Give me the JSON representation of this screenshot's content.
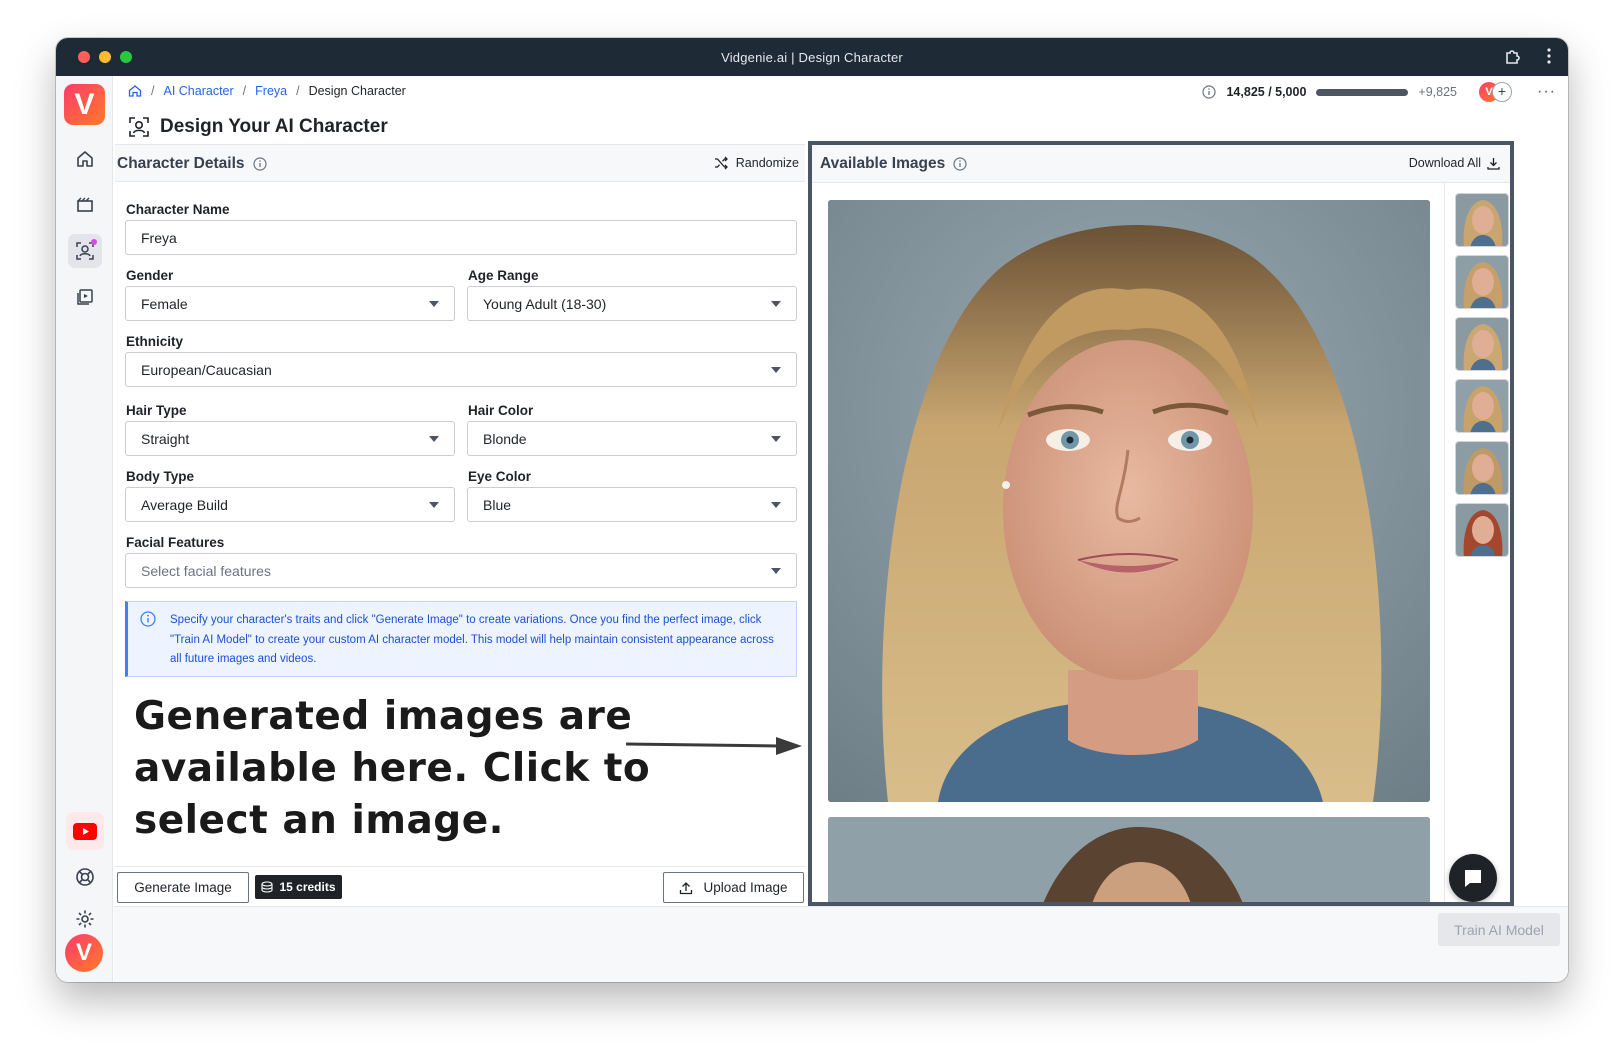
{
  "window": {
    "title": "Vidgenie.ai | Design Character"
  },
  "sidebar": {
    "items": [
      {
        "name": "home",
        "icon": "home-icon"
      },
      {
        "name": "videos",
        "icon": "clapperboard-icon"
      },
      {
        "name": "ai-character",
        "icon": "user-scan-icon",
        "active": true
      },
      {
        "name": "library",
        "icon": "media-library-icon"
      }
    ],
    "bottom": [
      {
        "icon": "youtube-icon"
      },
      {
        "icon": "help-lifebuoy-icon"
      },
      {
        "icon": "gear-icon"
      }
    ]
  },
  "breadcrumb": {
    "home_icon": "home-icon",
    "items": [
      "AI Character",
      "Freya",
      "Design Character"
    ],
    "separator": "/"
  },
  "credits": {
    "current": "14,825 / 5,000",
    "bonus": "+9,825",
    "usage_fraction": 1.0
  },
  "page": {
    "title": "Design Your AI Character"
  },
  "character_details": {
    "title": "Character Details",
    "randomize_label": "Randomize",
    "fields": {
      "name": {
        "label": "Character Name",
        "value": "Freya"
      },
      "gender": {
        "label": "Gender",
        "value": "Female"
      },
      "age_range": {
        "label": "Age Range",
        "value": "Young Adult (18-30)"
      },
      "ethnicity": {
        "label": "Ethnicity",
        "value": "European/Caucasian"
      },
      "hair_type": {
        "label": "Hair Type",
        "value": "Straight"
      },
      "hair_color": {
        "label": "Hair Color",
        "value": "Blonde"
      },
      "body_type": {
        "label": "Body Type",
        "value": "Average Build"
      },
      "eye_color": {
        "label": "Eye Color",
        "value": "Blue"
      },
      "facial_features": {
        "label": "Facial Features",
        "placeholder": "Select facial features"
      }
    },
    "info_text": "Specify your character's traits and click \"Generate Image\" to create variations. Once you find the perfect image, click \"Train AI Model\" to create your custom AI character model. This model will help maintain consistent appearance across all future images and videos."
  },
  "annotation": {
    "text": "Generated images are available here. Click to select an image."
  },
  "actions": {
    "generate_label": "Generate Image",
    "credits_label": "15 credits",
    "upload_label": "Upload Image",
    "train_label": "Train AI Model"
  },
  "available_images": {
    "title": "Available Images",
    "download_label": "Download All",
    "thumbnail_count": 6
  },
  "colors": {
    "titlebar": "#1f2a37",
    "accent": "#2563eb",
    "brand_gradient": [
      "#ff3b6b",
      "#ff7a29"
    ],
    "info_bg": "#edf4ff"
  }
}
